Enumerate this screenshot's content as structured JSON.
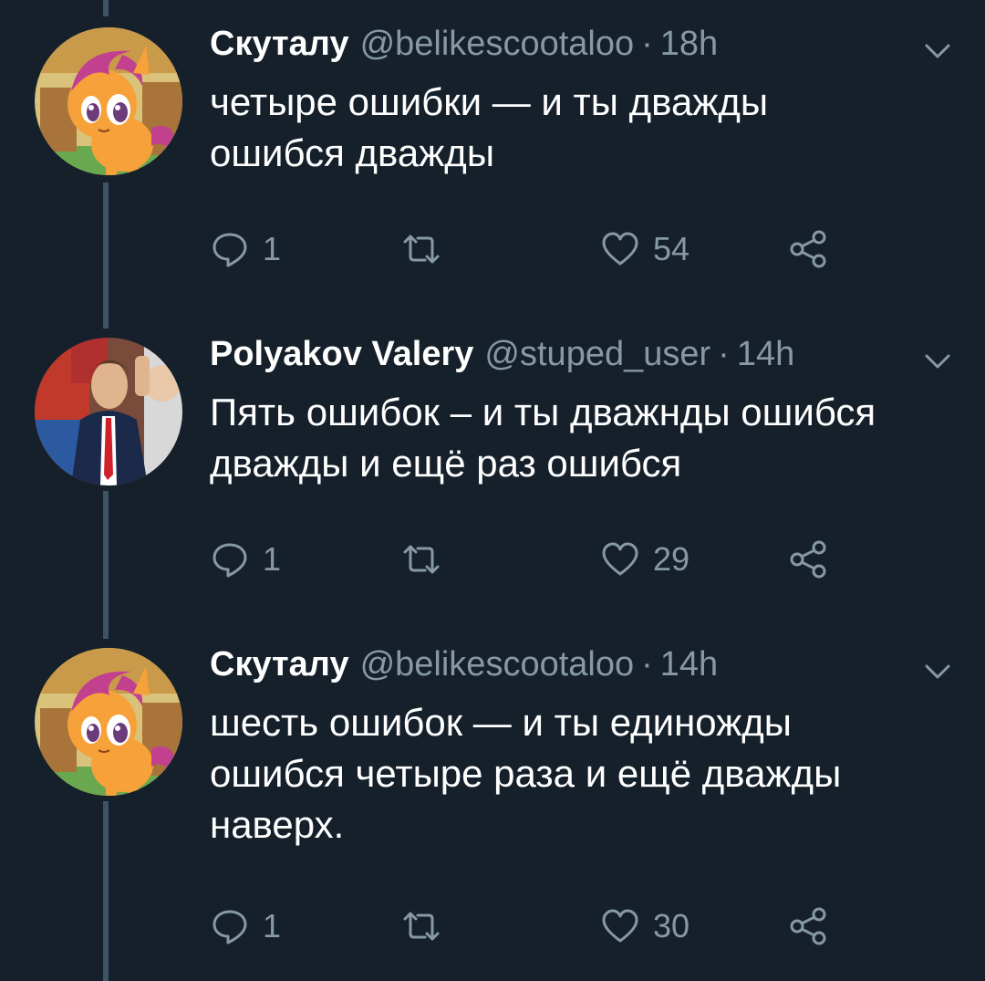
{
  "colors": {
    "background": "#15202b",
    "thread_line": "#3d5466",
    "secondary_text": "#8899a6"
  },
  "icons": {
    "reply": "reply-icon",
    "retweet": "retweet-icon",
    "like": "heart-icon",
    "share": "share-icon",
    "menu": "chevron-down-icon"
  },
  "tweets": [
    {
      "name": "Скуталу",
      "handle": "@belikescootaloo",
      "separator": "·",
      "time": "18h",
      "lines": [
        "четыре ошибки — и ты дважды",
        "ошибся дважды"
      ],
      "replies": "1",
      "retweets": "",
      "likes": "54"
    },
    {
      "name": "Polyakov Valery",
      "handle": "@stuped_user",
      "separator": "·",
      "time": "14h",
      "lines": [
        "Пять ошибок – и ты дважнды ошибся",
        "дважды и ещё раз ошибся"
      ],
      "replies": "1",
      "retweets": "",
      "likes": "29"
    },
    {
      "name": "Скуталу",
      "handle": "@belikescootaloo",
      "separator": "·",
      "time": "14h",
      "lines": [
        "шесть ошибок — и ты единожды",
        "ошибся четыре раза и ещё дважды",
        "наверх."
      ],
      "replies": "1",
      "retweets": "",
      "likes": "30"
    }
  ]
}
